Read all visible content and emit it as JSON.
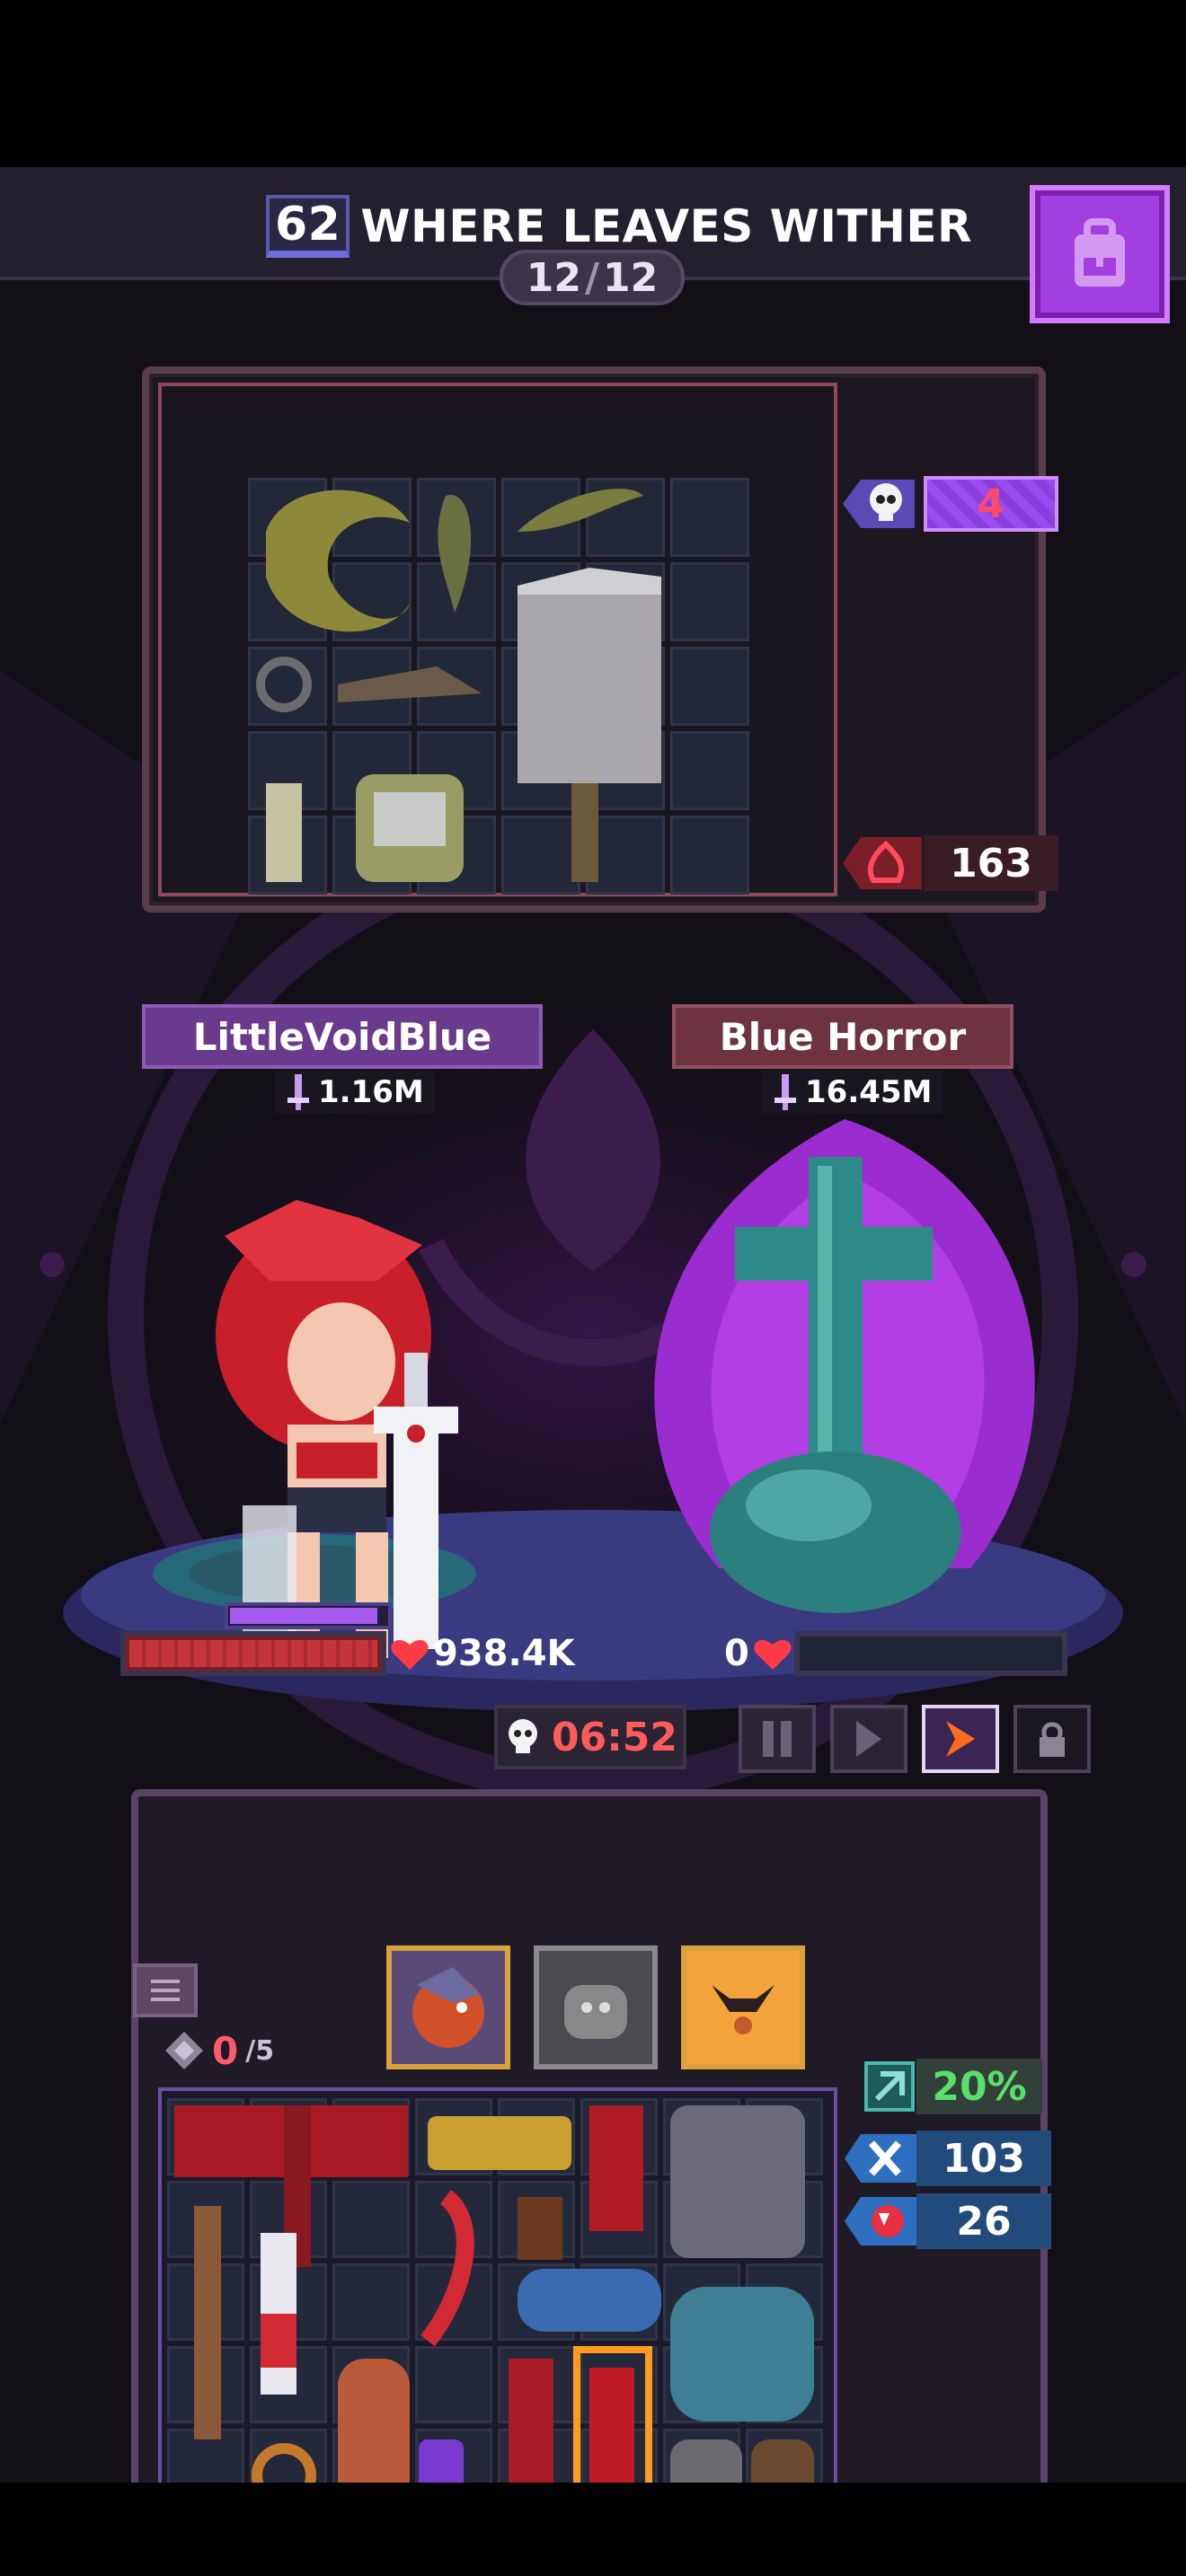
{
  "header": {
    "level": "62",
    "stage_name": "WHERE LEAVES WITHER",
    "wave_current": "12",
    "wave_total": "12"
  },
  "loot_panel": {
    "skull_count": "4",
    "rage_count": "163"
  },
  "player": {
    "name": "LittleVoidBlue",
    "power": "1.16M",
    "hp": "938.4K"
  },
  "enemy": {
    "name": "Blue Horror",
    "power": "16.45M",
    "hp": "0"
  },
  "battle": {
    "timer": "06:52"
  },
  "inventory": {
    "slots_used": "0",
    "slots_max": "/5",
    "stat_crit": "20%",
    "stat_kills": "103",
    "stat_bites": "26"
  },
  "colors": {
    "accent_purple": "#a33ee0",
    "timer_red": "#ff5b5b",
    "crit_green": "#58e06a",
    "skull_red": "#ff4b6b"
  },
  "icons": [
    "backpack-icon",
    "skull-icon",
    "flame-icon",
    "sword-icon",
    "heart-icon",
    "pause-icon",
    "play-icon",
    "fast-forward-icon",
    "lock-icon",
    "list-icon",
    "gem-icon",
    "crit-icon",
    "crossed-bones-icon",
    "fangs-icon"
  ]
}
